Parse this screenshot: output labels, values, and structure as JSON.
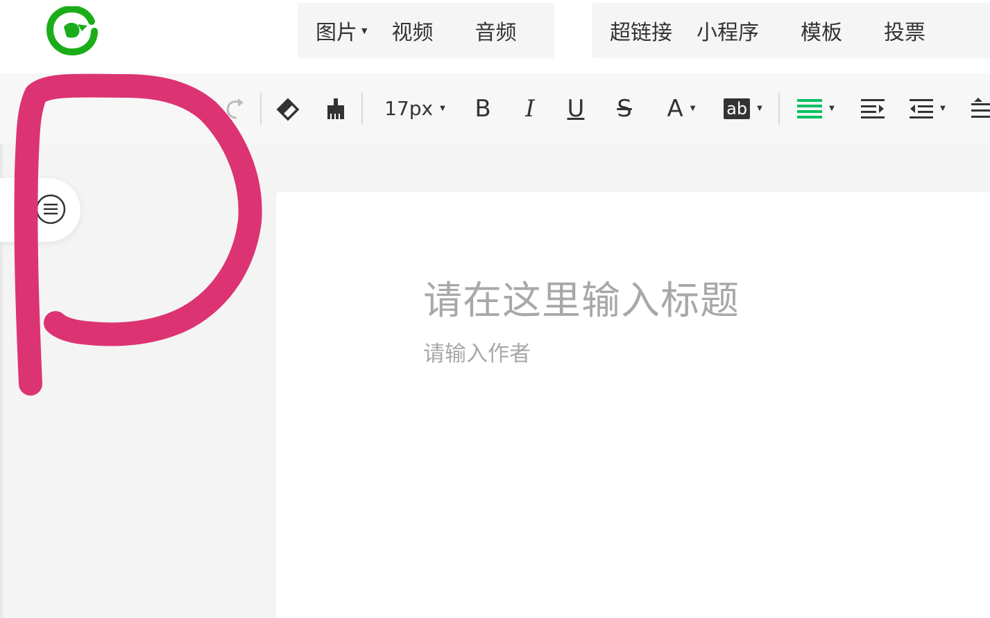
{
  "colors": {
    "brand_green": "#1aad19",
    "accent_active": "#07c160",
    "annotation": "#dc3373",
    "placeholder": "#a8a8a8"
  },
  "header": {
    "logo_icon": "wechat-logo-icon",
    "media_menu": [
      {
        "label": "图片",
        "has_dropdown": true
      },
      {
        "label": "视频",
        "has_dropdown": false
      },
      {
        "label": "音频",
        "has_dropdown": false
      }
    ],
    "insert_menu": [
      {
        "label": "超链接"
      },
      {
        "label": "小程序"
      },
      {
        "label": "模板"
      },
      {
        "label": "投票"
      }
    ]
  },
  "toolbar": {
    "font_size": "17px",
    "bold_label": "B",
    "italic_label": "I",
    "underline_label": "U",
    "strike_label": "S",
    "font_color_label": "A",
    "highlight_label": "ab",
    "icons": [
      "undo-icon",
      "redo-icon",
      "eraser-icon",
      "format-brush-icon",
      "align-justify-icon",
      "indent-right-icon",
      "indent-icon",
      "line-spacing-icon"
    ]
  },
  "sidebar": {
    "outline_icon": "outline-list-icon"
  },
  "editor": {
    "title_placeholder": "请在这里输入标题",
    "author_placeholder": "请输入作者"
  }
}
